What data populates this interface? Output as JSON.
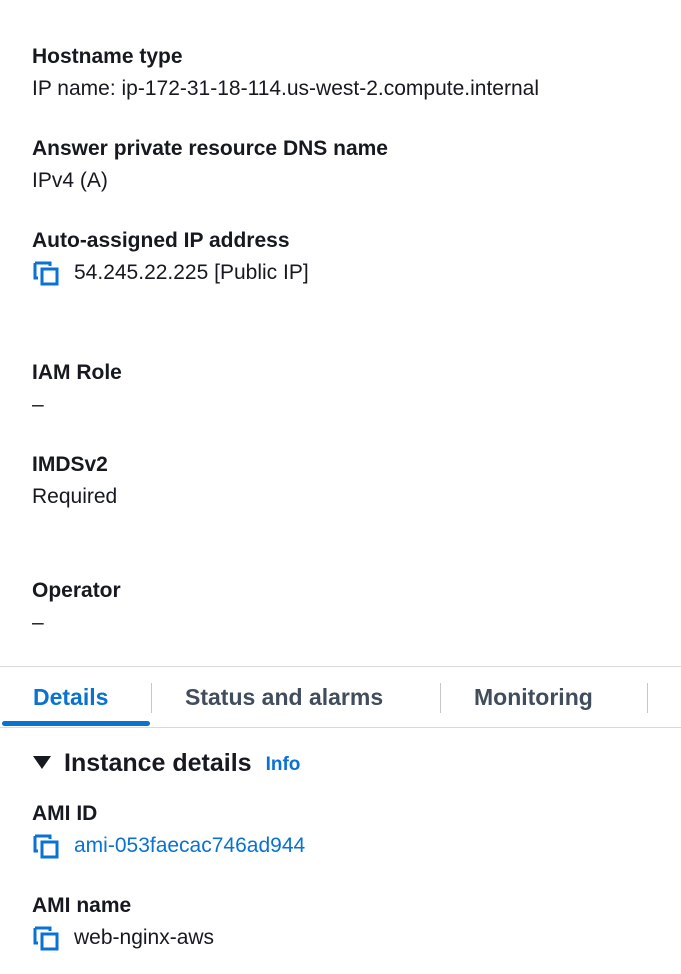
{
  "details_top": {
    "hostname_type": {
      "label": "Hostname type",
      "value": "IP name: ip-172-31-18-114.us-west-2.compute.internal"
    },
    "answer_dns": {
      "label": "Answer private resource DNS name",
      "value": "IPv4 (A)"
    },
    "auto_ip": {
      "label": "Auto-assigned IP address",
      "value": "54.245.22.225 [Public IP]",
      "icon": "copy-icon"
    },
    "iam_role": {
      "label": "IAM Role",
      "value": "–"
    },
    "imdsv2": {
      "label": "IMDSv2",
      "value": "Required"
    },
    "operator": {
      "label": "Operator",
      "value": "–"
    }
  },
  "tabs": [
    {
      "label": "Details",
      "active": true
    },
    {
      "label": "Status and alarms",
      "active": false
    },
    {
      "label": "Monitoring",
      "active": false
    }
  ],
  "instance_details": {
    "title": "Instance details",
    "info_label": "Info",
    "ami_id": {
      "label": "AMI ID",
      "value": "ami-053faecac746ad944",
      "icon": "copy-icon"
    },
    "ami_name": {
      "label": "AMI name",
      "value": "web-nginx-aws",
      "icon": "copy-icon"
    }
  },
  "colors": {
    "link": "#0972d3",
    "text": "#16191f",
    "tab_inactive": "#414d5c",
    "divider": "#d5dbdb"
  }
}
